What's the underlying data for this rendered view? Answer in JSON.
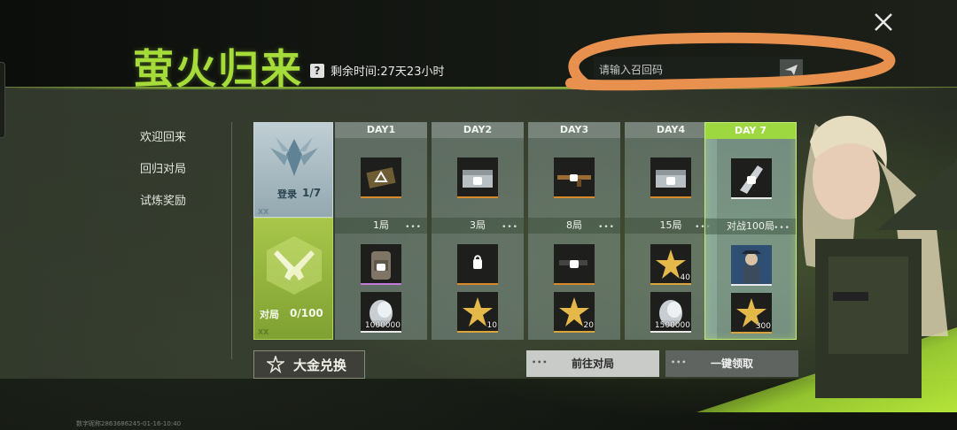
{
  "header": {
    "title": "萤火归来",
    "help": "?",
    "time_remaining": "剩余时间:27天23小时",
    "code_placeholder": "请输入召回码"
  },
  "nav": {
    "items": [
      "欢迎回来",
      "回归对局",
      "试炼奖励"
    ]
  },
  "rows": {
    "login_label": "登录",
    "login_progress": "1/7",
    "battle_label": "对局",
    "battle_progress": "0/100",
    "watermark": "XX"
  },
  "days": [
    {
      "label": "DAY1",
      "requirement": "1局",
      "items": [
        {
          "icon": "card-icon",
          "qty": ""
        },
        {
          "icon": "backpack-icon",
          "qty": ""
        },
        {
          "icon": "silver-coin-icon",
          "qty": "1000000"
        }
      ]
    },
    {
      "label": "DAY2",
      "requirement": "3局",
      "items": [
        {
          "icon": "crate-icon",
          "qty": ""
        },
        {
          "icon": "helmet-icon",
          "qty": ""
        },
        {
          "icon": "gold-star-icon",
          "qty": "10"
        }
      ]
    },
    {
      "label": "DAY3",
      "requirement": "8局",
      "items": [
        {
          "icon": "rifle-icon",
          "qty": ""
        },
        {
          "icon": "pistol-icon",
          "qty": ""
        },
        {
          "icon": "gold-star-icon",
          "qty": "20"
        }
      ]
    },
    {
      "label": "DAY4",
      "requirement": "15局",
      "items": [
        {
          "icon": "crate-icon",
          "qty": ""
        },
        {
          "icon": "gold-star-icon",
          "qty": "40"
        },
        {
          "icon": "silver-coin-icon",
          "qty": "1500000"
        }
      ]
    },
    {
      "label": "DAY 7",
      "requirement": "对战100局",
      "items": [
        {
          "icon": "knife-icon",
          "qty": ""
        },
        {
          "icon": "character-card-icon",
          "qty": ""
        },
        {
          "icon": "gold-star-icon",
          "qty": "300"
        }
      ]
    }
  ],
  "buttons": {
    "exchange": "大金兑换",
    "goto_battle": "前往对局",
    "claim_all": "一键领取"
  },
  "footer": {
    "player_id": "数字昵称2863686245-01-16-10:40"
  },
  "colors": {
    "accent_green": "#a6dc3a",
    "orange_border": "#d9892a",
    "scribble": "#e8904e"
  }
}
